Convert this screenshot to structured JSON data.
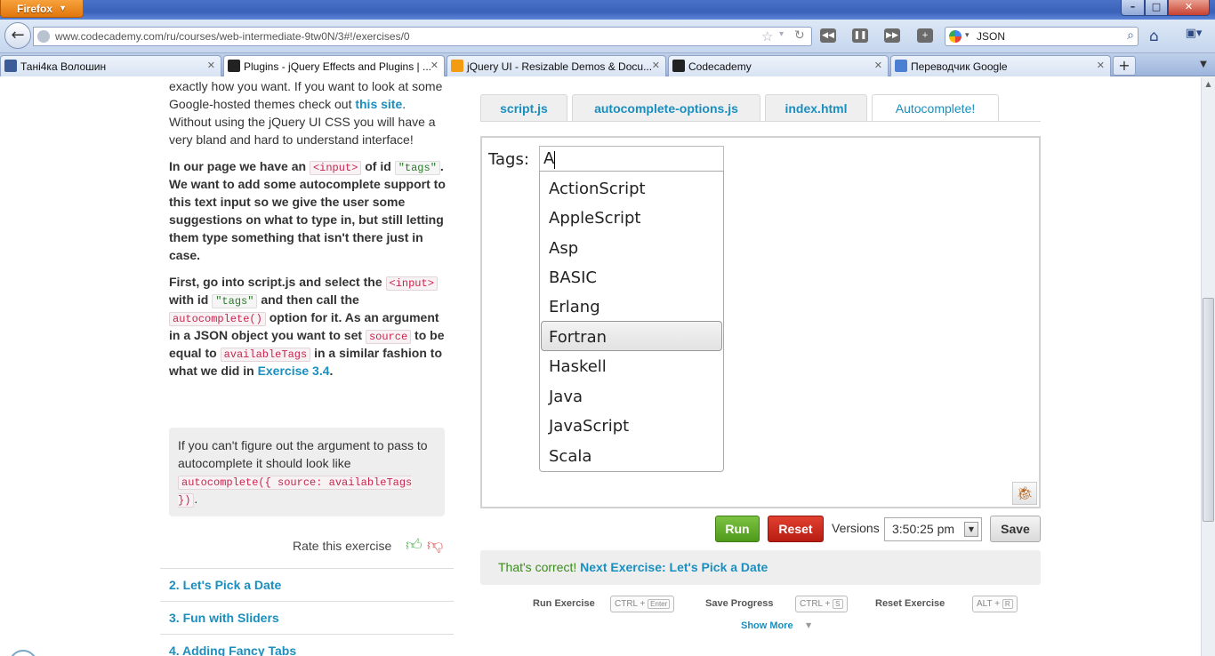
{
  "browser": {
    "app_button": "Firefox",
    "url": "www.codecademy.com/ru/courses/web-intermediate-9tw0N/3#!/exercises/0",
    "search_value": "JSON",
    "window_buttons": {
      "minimize": "–",
      "maximize": "□",
      "close": "✕"
    },
    "tabs": [
      {
        "title": "Тані4ка Волошин",
        "favicon_color": "#3b5b99"
      },
      {
        "title": "Plugins - jQuery Effects and Plugins | ...",
        "favicon_color": "#222222"
      },
      {
        "title": "jQuery UI - Resizable Demos & Docu...",
        "favicon_color": "#f39c12"
      },
      {
        "title": "Codecademy",
        "favicon_color": "#222222"
      },
      {
        "title": "Переводчик Google",
        "favicon_color": "#4a7fd1"
      }
    ]
  },
  "instructions": {
    "p1_pre": "exactly how you want. If you want to look at some Google-hosted themes check out ",
    "p1_link": "this site",
    "p1_post": ". Without using the jQuery UI CSS you will have a very bland and hard to understand interface!",
    "p2_a": "In our page we have an ",
    "p2_code1": "<input>",
    "p2_b": " of id ",
    "p2_code2": "\"tags\"",
    "p2_c": ". We want to add some autocomplete support to this text input so we give the user some suggestions on what to type in, but still letting them type something that isn't there just in case.",
    "p3_a": "First, go into script.js and select the ",
    "p3_code1": "<input>",
    "p3_b": " with id ",
    "p3_code2": "\"tags\"",
    "p3_c": " and then call the ",
    "p3_code3": "autocomplete()",
    "p3_d": " option for it. As an argument in a JSON object you want to set ",
    "p3_code4": "source",
    "p3_e": " to be equal to ",
    "p3_code5": "availableTags",
    "p3_f": " in a similar fashion to what we did in ",
    "p3_link": "Exercise 3.4",
    "p3_g": "."
  },
  "hint": {
    "text": "If you can't figure out the argument to pass to autocomplete it should look like ",
    "code": "autocomplete({ source: availableTags })",
    "end": "."
  },
  "rate": {
    "label": "Rate this exercise"
  },
  "lessons": [
    "2. Let's Pick a Date",
    "3. Fun with Sliders",
    "4. Adding Fancy Tabs"
  ],
  "editor": {
    "tabs": [
      "script.js",
      "autocomplete-options.js",
      "index.html",
      "Autocomplete!"
    ],
    "active_tab": "Autocomplete!"
  },
  "preview": {
    "tags_label": "Tags:",
    "input_value": "A",
    "suggestions": [
      "ActionScript",
      "AppleScript",
      "Asp",
      "BASIC",
      "Erlang",
      "Fortran",
      "Haskell",
      "Java",
      "JavaScript",
      "Scala"
    ],
    "hovered": "Fortran"
  },
  "controls": {
    "run": "Run",
    "reset": "Reset",
    "versions_label": "Versions",
    "version_value": "3:50:25 pm",
    "save": "Save"
  },
  "result": {
    "correct_text": "That's correct!",
    "next_link": "Next Exercise: Let's Pick a Date"
  },
  "shortcuts": [
    {
      "label": "Run Exercise",
      "mod": "CTRL +",
      "key": "Enter"
    },
    {
      "label": "Save Progress",
      "mod": "CTRL +",
      "key": "S"
    },
    {
      "label": "Reset Exercise",
      "mod": "ALT +",
      "key": "R"
    }
  ],
  "show_more": "Show More",
  "colors": {
    "link": "#1a8fbf",
    "run_button": "#5aa62a",
    "reset_button": "#c8281c",
    "correct_text": "#3a8a1c"
  }
}
